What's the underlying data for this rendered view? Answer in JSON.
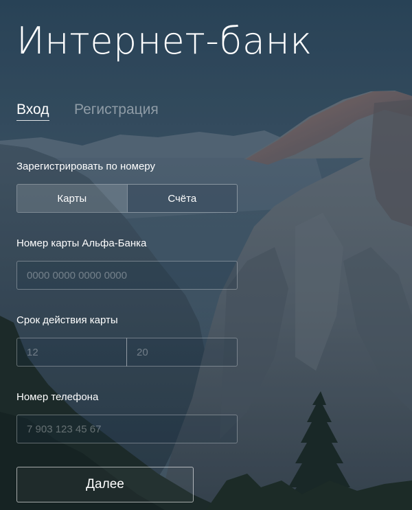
{
  "app": {
    "title": "Интернет-банк"
  },
  "tabs": {
    "login_label": "Вход",
    "register_label": "Регистрация",
    "active": "login"
  },
  "register_by": {
    "label": "Зарегистрировать по номеру",
    "options": [
      "Карты",
      "Счёта"
    ],
    "selected": "Карты"
  },
  "card_number": {
    "label": "Номер карты Альфа-Банка",
    "value": "",
    "placeholder": "0000 0000 0000 0000"
  },
  "expiry": {
    "label": "Срок действия карты",
    "month": {
      "value": "",
      "placeholder": "12"
    },
    "year": {
      "value": "",
      "placeholder": "20"
    }
  },
  "phone": {
    "label": "Номер телефона",
    "value": "",
    "placeholder": "7 903 123 45 67"
  },
  "submit": {
    "label": "Далее"
  },
  "colors": {
    "text": "#ffffff",
    "sky_top": "#2f4a5f",
    "sky_bottom": "#5b6e7b",
    "sunlit_peak": "#b8786a"
  }
}
